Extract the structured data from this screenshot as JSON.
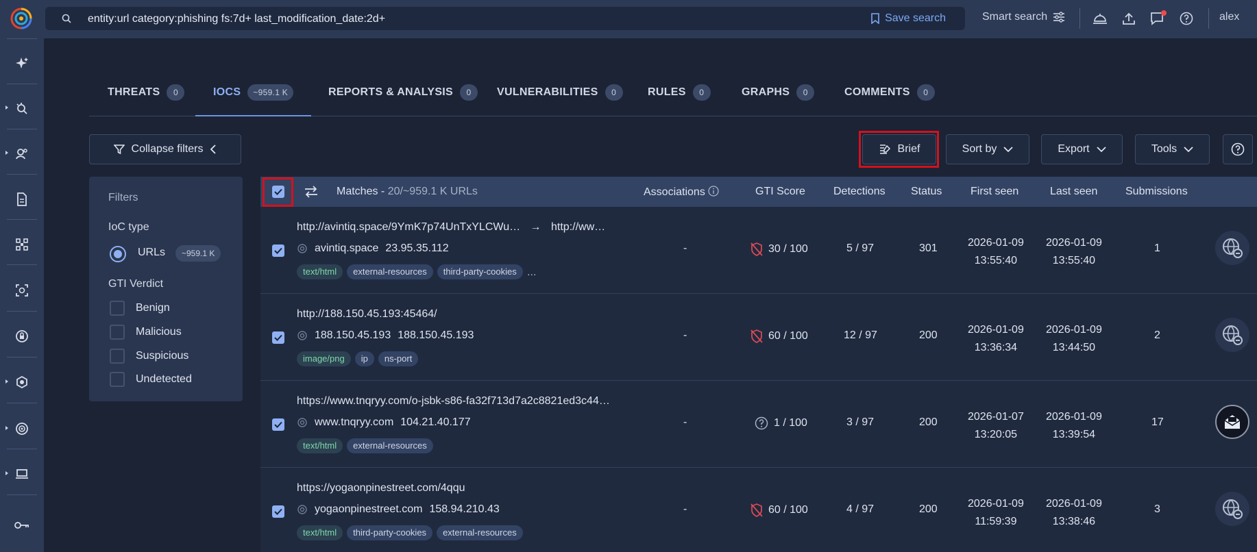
{
  "search": {
    "query": "entity:url category:phishing fs:7d+ last_modification_date:2d+",
    "save_label": "Save search",
    "smart_label": "Smart search"
  },
  "user": {
    "name": "alex"
  },
  "tabs": [
    {
      "label": "THREATS",
      "count": "0"
    },
    {
      "label": "IOCS",
      "count": "~959.1 K"
    },
    {
      "label": "REPORTS & ANALYSIS",
      "count": "0"
    },
    {
      "label": "VULNERABILITIES",
      "count": "0"
    },
    {
      "label": "RULES",
      "count": "0"
    },
    {
      "label": "GRAPHS",
      "count": "0"
    },
    {
      "label": "COMMENTS",
      "count": "0"
    }
  ],
  "toolbar": {
    "collapse_filters": "Collapse filters",
    "brief": "Brief",
    "sort_by": "Sort by",
    "export": "Export",
    "tools": "Tools"
  },
  "filters": {
    "title": "Filters",
    "ioc_type_label": "IoC type",
    "ioc_type_option": "URLs",
    "ioc_type_count": "~959.1 K",
    "verdict_label": "GTI Verdict",
    "verdicts": [
      "Benign",
      "Malicious",
      "Suspicious",
      "Undetected"
    ]
  },
  "table": {
    "matches_label": "Matches -",
    "matches_count": "20/~959.1 K URLs",
    "columns": {
      "associations": "Associations",
      "gti_score": "GTI Score",
      "detections": "Detections",
      "status": "Status",
      "first_seen": "First seen",
      "last_seen": "Last seen",
      "submissions": "Submissions"
    },
    "rows": [
      {
        "url": "http://avintiq.space/9YmK7p74UnTxYLCWu…",
        "redirect": "http://ww…",
        "host": "avintiq.space",
        "ip": "23.95.35.112",
        "tags": [
          "text/html",
          "external-resources",
          "third-party-cookies"
        ],
        "more": "…",
        "associations": "-",
        "gti_score": "30 / 100",
        "detections": "5 / 97",
        "status": "301",
        "first_seen_date": "2026-01-09",
        "first_seen_time": "13:55:40",
        "last_seen_date": "2026-01-09",
        "last_seen_time": "13:55:40",
        "submissions": "1"
      },
      {
        "url": "http://188.150.45.193:45464/",
        "host": "188.150.45.193",
        "ip": "188.150.45.193",
        "tags": [
          "image/png",
          "ip",
          "ns-port"
        ],
        "associations": "-",
        "gti_score": "60 / 100",
        "detections": "12 / 97",
        "status": "200",
        "first_seen_date": "2026-01-09",
        "first_seen_time": "13:36:34",
        "last_seen_date": "2026-01-09",
        "last_seen_time": "13:44:50",
        "submissions": "2"
      },
      {
        "url": "https://www.tnqryy.com/o-jsbk-s86-fa32f713d7a2c8821ed3c44…",
        "host": "www.tnqryy.com",
        "ip": "104.21.40.177",
        "tags": [
          "text/html",
          "external-resources"
        ],
        "associations": "-",
        "gti_score": "1 / 100",
        "detections": "3 / 97",
        "status": "200",
        "first_seen_date": "2026-01-07",
        "first_seen_time": "13:20:05",
        "last_seen_date": "2026-01-09",
        "last_seen_time": "13:39:54",
        "submissions": "17"
      },
      {
        "url": "https://yogaonpinestreet.com/4qqu",
        "host": "yogaonpinestreet.com",
        "ip": "158.94.210.43",
        "tags": [
          "text/html",
          "third-party-cookies",
          "external-resources"
        ],
        "associations": "-",
        "gti_score": "60 / 100",
        "detections": "4 / 97",
        "status": "200",
        "first_seen_date": "2026-01-09",
        "first_seen_time": "11:59:39",
        "last_seen_date": "2026-01-09",
        "last_seen_time": "13:38:46",
        "submissions": "3"
      }
    ]
  },
  "colors": {
    "accent": "#8fb1f3",
    "highlight": "#d3121c",
    "danger": "#e04a55",
    "tag_green": "#7fd7a6"
  },
  "icons": {
    "rail": [
      "sparkle-icon",
      "threat-hunt-icon",
      "actor-icon",
      "report-icon",
      "graph-icon",
      "scan-icon",
      "lock-icon",
      "hexagon-icon",
      "radar-icon",
      "monitor-icon",
      "key-icon"
    ]
  }
}
